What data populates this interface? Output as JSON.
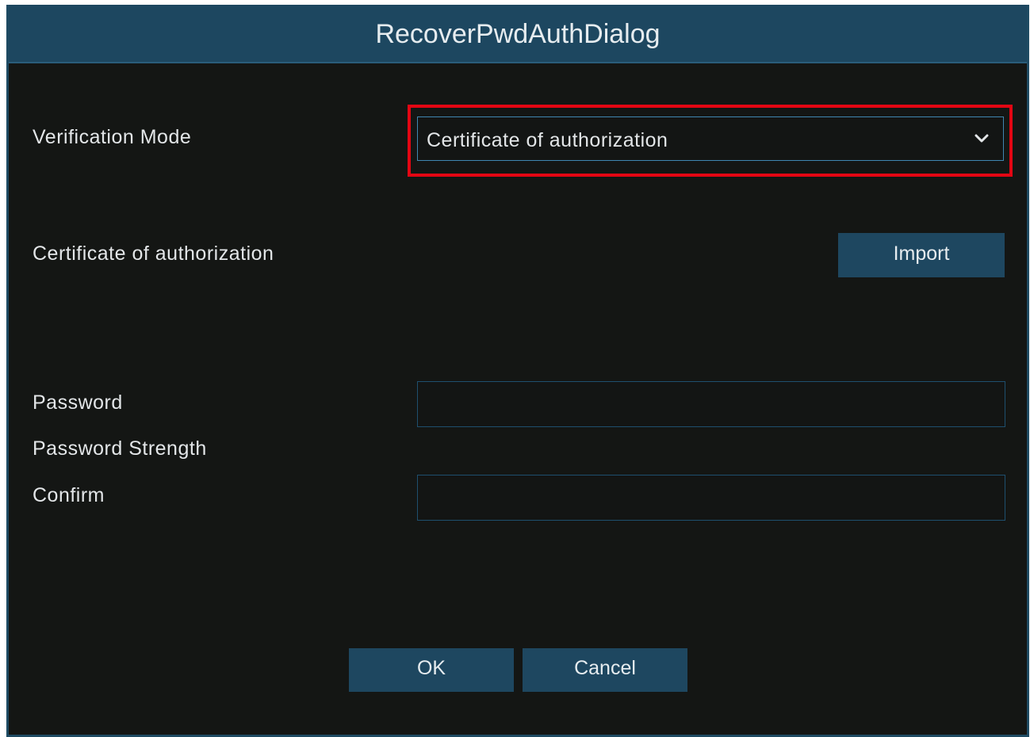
{
  "dialog": {
    "title": "RecoverPwdAuthDialog"
  },
  "verification_mode": {
    "label": "Verification Mode",
    "selected": "Certificate of authorization"
  },
  "certificate": {
    "label": "Certificate of authorization",
    "import_label": "Import"
  },
  "password": {
    "label": "Password",
    "value": ""
  },
  "password_strength": {
    "label": "Password Strength"
  },
  "confirm": {
    "label": "Confirm",
    "value": ""
  },
  "buttons": {
    "ok": "OK",
    "cancel": "Cancel"
  },
  "colors": {
    "background": "#141614",
    "titlebar": "#1d4760",
    "button": "#1e4760",
    "select_border": "#3f87b0",
    "highlight": "#e30613",
    "text": "#e3e6e8"
  },
  "icons": {
    "dropdown": "chevron-down-icon"
  }
}
